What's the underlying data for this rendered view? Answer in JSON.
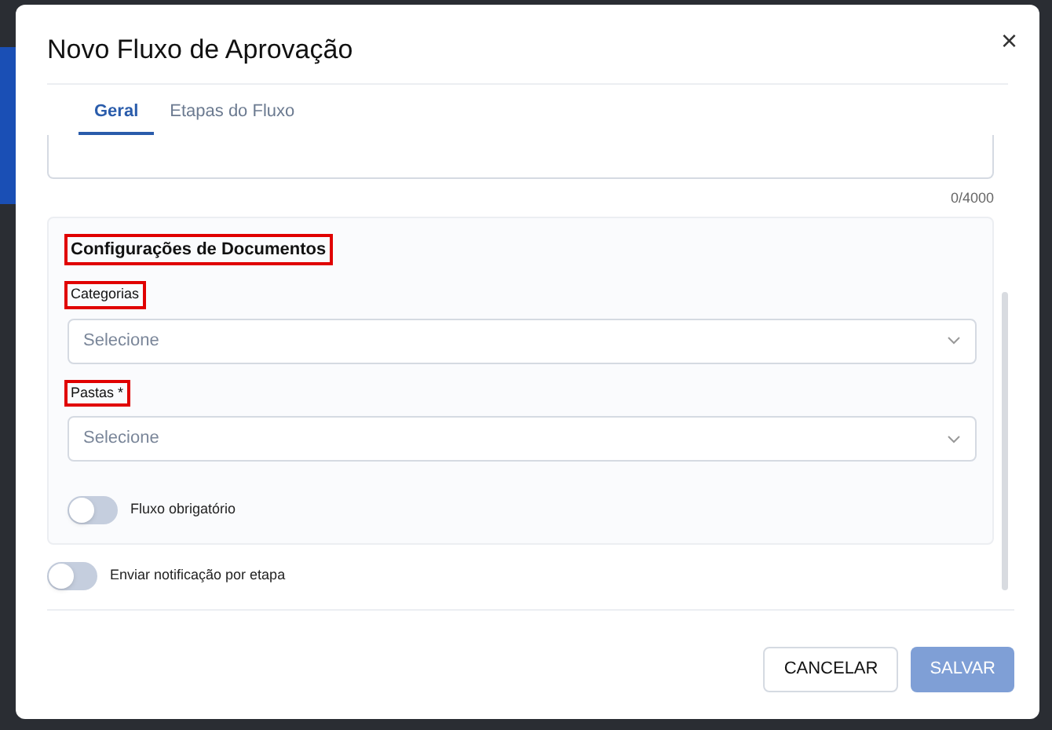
{
  "dialog": {
    "title": "Novo Fluxo de Aprovação",
    "close_icon": "×"
  },
  "tabs": [
    {
      "label": "Geral",
      "selected": true
    },
    {
      "label": "Etapas do Fluxo",
      "selected": false
    }
  ],
  "textarea": {
    "counter": "0/4000"
  },
  "section": {
    "title": "Configurações de Documentos",
    "highlighted": true,
    "fields": [
      {
        "label": "Categorias",
        "highlighted": true,
        "placeholder": "Selecione"
      },
      {
        "label": "Pastas *",
        "highlighted": true,
        "placeholder": "Selecione"
      }
    ],
    "toggle": {
      "label": "Fluxo obrigatório",
      "on": false
    }
  },
  "toggle": {
    "label": "Enviar notificação por etapa",
    "on": false
  },
  "buttons": [
    {
      "label": "CANCELAR",
      "kind": "secondary",
      "disabled": false
    },
    {
      "label": "SALVAR",
      "kind": "primary",
      "disabled": true
    }
  ]
}
